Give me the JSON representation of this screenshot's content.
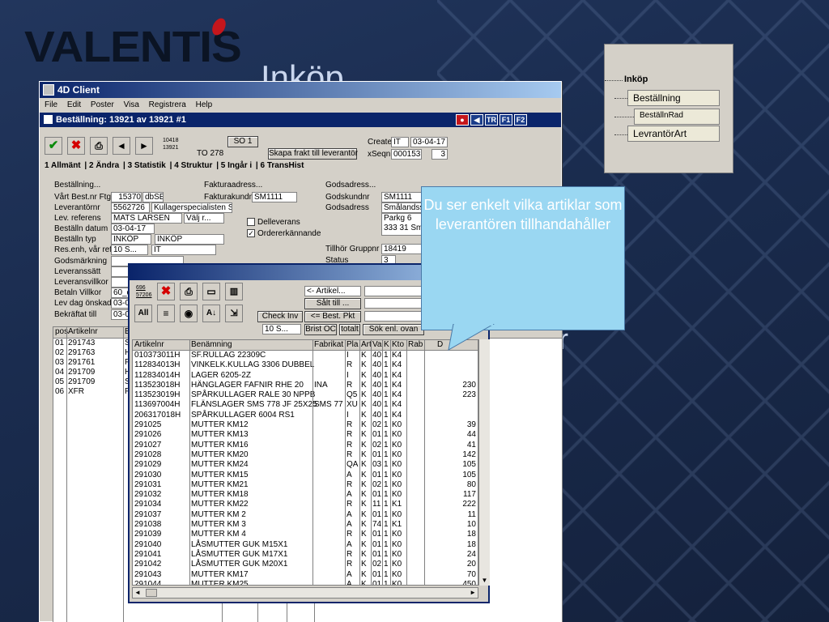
{
  "slide": {
    "title": "Inköp",
    "bg_fragments": [
      "r",
      "ar",
      "lt"
    ]
  },
  "logo": {
    "text": "VALENTIS"
  },
  "tree": {
    "root": "Inköp",
    "items": [
      "Beställning",
      "BeställnRad",
      "LevrantörArt"
    ]
  },
  "app": {
    "title": "4D Client",
    "menu": [
      "File",
      "Edit",
      "Poster",
      "Visa",
      "Registrera",
      "Help"
    ]
  },
  "order": {
    "title": "Beställning: 13921 av 13921   #1",
    "title_buttons": [
      "TR",
      "F1",
      "F2"
    ],
    "stamp_top": "10418",
    "stamp_bottom": "13921",
    "so": "SO 1",
    "to": "TO 278",
    "create_btn": "Skapa frakt till leverantör",
    "create_label": "Create",
    "create_user": "IT",
    "create_date": "03-04-17",
    "xseq_label": "xSeqnr",
    "xseq": "000153",
    "xseq2": "3",
    "tabs": [
      "1 Allmänt",
      "2 Ändra",
      "3 Statistik",
      "4 Struktur",
      "5 Ingår i",
      "6 TransHist"
    ],
    "sections": {
      "bestallning": "Beställning...",
      "faktura": "Fakturaadress...",
      "gods": "Godsadress..."
    },
    "labels": [
      "Vårt Best.nr Ftg",
      "Leverantörnr",
      "Lev. referens",
      "Beställn datum",
      "Beställn typ",
      "Res.enh, vår ref",
      "Godsmärkning",
      "Leveranssätt",
      "Leveransvillkor",
      "Betaln Villkor",
      "Lev dag önskad",
      "Bekräftat till"
    ],
    "values": {
      "best_nr": "15370",
      "best_ftg": "dbSE",
      "lev_nr": "5562726",
      "lev_name": "Kullagerspecialisten Sv",
      "lev_ref": "MATS LARSEN",
      "lev_ref_sel": "Välj r...",
      "datum": "03-04-17",
      "typ": "INKÖP",
      "typ_sel": "INKÖP",
      "res": "10 S...",
      "var_ref": "IT",
      "betaln": "60_d",
      "levdag": "03-0",
      "bekraftat": "03-0"
    },
    "faktura_kundnr_label": "Fakturakundnr",
    "faktura_kundnr": "SM1111",
    "delleverans": "Delleverans",
    "ordererk": "Ordererkännande",
    "ordererk_check": "✓",
    "gods_kundnr_label": "Godskundnr",
    "gods_kundnr": "SM1111",
    "gods_adress_label": "Godsadress",
    "gods_adress": "Smålandsst",
    "gods_line1": "Parkg 6",
    "gods_line2": "333 31  Sm",
    "grupp_label": "Tillhör Gruppnr",
    "grupp": "18419",
    "status_label": "Status",
    "status": "3",
    "rows_header": [
      "pos",
      "Artikelnr",
      "B"
    ],
    "rows": [
      [
        "01",
        "291743",
        "S"
      ],
      [
        "02",
        "291763",
        "H"
      ],
      [
        "03",
        "291761",
        "F"
      ],
      [
        "04",
        "291709",
        "H"
      ],
      [
        "05",
        "291709",
        "S"
      ],
      [
        "06",
        "XFR",
        "F"
      ]
    ]
  },
  "popup": {
    "stamp_top": "696",
    "stamp_bottom": "57206",
    "all_label": "All",
    "artikel_sel": "<- Artikel...",
    "salt_btn": "Sålt till ...",
    "best_btn": "<= Best. Pkt",
    "check_btn": "Check Inv",
    "res_sel": "10 S...",
    "brist_btn": "Brist OC",
    "totalt_btn": "totalt",
    "sok_btn": "Sök enl. ovan",
    "headers": [
      "Artikelnr",
      "Benämning",
      "Fabrikat",
      "Pla",
      "Art",
      "Va",
      "K",
      "Kto",
      "Rab",
      "D"
    ],
    "rows": [
      [
        "010373011H",
        "SF.RULLAG 22309C",
        "",
        "I",
        "K",
        "40",
        "1",
        "K4",
        "",
        ""
      ],
      [
        "112834013H",
        "VINKELK.KULLAG 3306 DUBBEL",
        "",
        "R",
        "K",
        "40",
        "1",
        "K4",
        "",
        ""
      ],
      [
        "112834014H",
        "LAGER 6205-2Z",
        "",
        "I",
        "K",
        "40",
        "1",
        "K4",
        "",
        ""
      ],
      [
        "113523018H",
        "HÄNGLAGER FAFNIR RHE 20",
        "INA",
        "R",
        "K",
        "40",
        "1",
        "K4",
        "",
        "230"
      ],
      [
        "113523019H",
        "SPÅRKULLAGER RALE 30 NPPB",
        "",
        "Q5",
        "K",
        "40",
        "1",
        "K4",
        "",
        "223"
      ],
      [
        "113697004H",
        "FLÄNSLAGER SMS 778 JF 25X25",
        "SMS 77",
        "XU",
        "K",
        "40",
        "1",
        "K4",
        "",
        ""
      ],
      [
        "206317018H",
        "SPÅRKULLAGER 6004 RS1",
        "",
        "I",
        "K",
        "40",
        "1",
        "K4",
        "",
        ""
      ],
      [
        "291025",
        "MUTTER KM12",
        "",
        "R",
        "K",
        "02",
        "1",
        "K0",
        "",
        "39"
      ],
      [
        "291026",
        "MUTTER KM13",
        "",
        "R",
        "K",
        "01",
        "1",
        "K0",
        "",
        "44"
      ],
      [
        "291027",
        "MUTTER KM16",
        "",
        "R",
        "K",
        "02",
        "1",
        "K0",
        "",
        "41"
      ],
      [
        "291028",
        "MUTTER KM20",
        "",
        "R",
        "K",
        "01",
        "1",
        "K0",
        "",
        "142"
      ],
      [
        "291029",
        "MUTTER KM24",
        "",
        "QA",
        "K",
        "03",
        "1",
        "K0",
        "",
        "105"
      ],
      [
        "291030",
        "MUTTER KM15",
        "",
        "A",
        "K",
        "01",
        "1",
        "K0",
        "",
        "105"
      ],
      [
        "291031",
        "MUTTER KM21",
        "",
        "R",
        "K",
        "02",
        "1",
        "K0",
        "",
        "80"
      ],
      [
        "291032",
        "MUTTER KM18",
        "",
        "A",
        "K",
        "01",
        "1",
        "K0",
        "",
        "117"
      ],
      [
        "291034",
        "MUTTER KM22",
        "",
        "R",
        "K",
        "11",
        "1",
        "K1",
        "",
        "222"
      ],
      [
        "291037",
        "MUTTER KM 2",
        "",
        "A",
        "K",
        "01",
        "1",
        "K0",
        "",
        "11"
      ],
      [
        "291038",
        "MUTTER KM 3",
        "",
        "A",
        "K",
        "74",
        "1",
        "K1",
        "",
        "10"
      ],
      [
        "291039",
        "MUTTER KM 4",
        "",
        "R",
        "K",
        "01",
        "1",
        "K0",
        "",
        "18"
      ],
      [
        "291040",
        "LÅSMUTTER GUK M15X1",
        "",
        "A",
        "K",
        "01",
        "1",
        "K0",
        "",
        "18"
      ],
      [
        "291041",
        "LÅSMUTTER GUK M17X1",
        "",
        "R",
        "K",
        "01",
        "1",
        "K0",
        "",
        "24"
      ],
      [
        "291042",
        "LÅSMUTTER GUK M20X1",
        "",
        "R",
        "K",
        "02",
        "1",
        "K0",
        "",
        "20"
      ],
      [
        "291043",
        "MUTTER KM17",
        "",
        "A",
        "K",
        "01",
        "1",
        "K0",
        "",
        "70"
      ],
      [
        "291044",
        "MUTTER KM25",
        "",
        "A",
        "K",
        "01",
        "1",
        "K0",
        "",
        "450"
      ]
    ]
  },
  "callout": {
    "text": "Du ser enkelt vilka artiklar som leverantören tillhandahåller"
  }
}
